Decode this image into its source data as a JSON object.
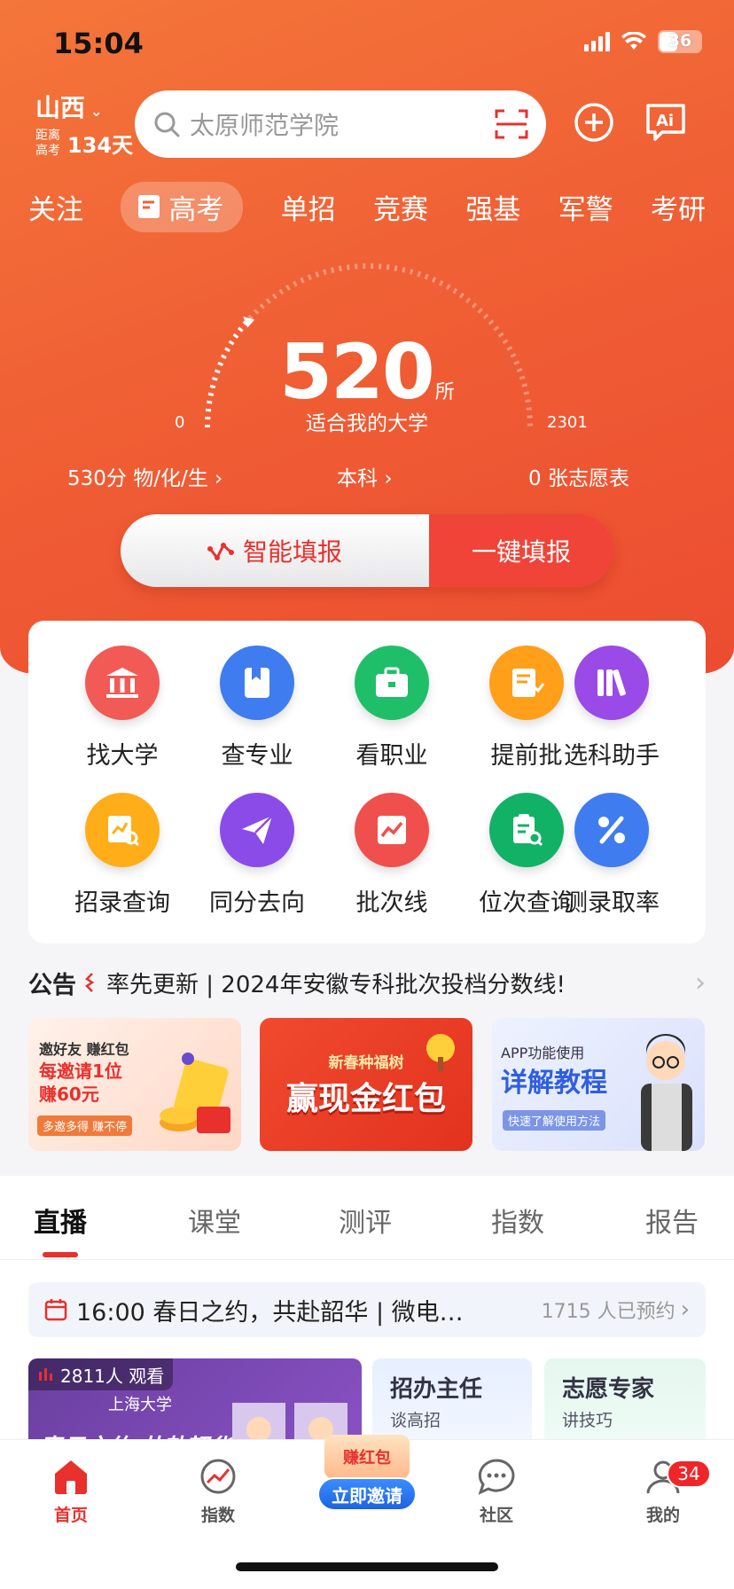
{
  "status": {
    "time": "15:04",
    "battery": "36"
  },
  "location": {
    "province": "山西",
    "countdown_label": "距离高考",
    "countdown_value": "134天"
  },
  "search": {
    "placeholder": "太原师范学院"
  },
  "categories": [
    "关注",
    "高考",
    "单招",
    "竞赛",
    "强基",
    "军警",
    "考研"
  ],
  "gauge": {
    "count": "520",
    "unit": "所",
    "subtitle": "适合我的大学",
    "min": "0",
    "max": "2301",
    "fill_fraction": 0.23
  },
  "stats": {
    "score": "530分 物/化/生",
    "level": "本科",
    "forms": "0 张志愿表"
  },
  "fill_buttons": {
    "smart": "智能填报",
    "one_click": "一键填报"
  },
  "functions": [
    {
      "label": "找大学",
      "icon": "university-icon",
      "color": "#f25a56"
    },
    {
      "label": "查专业",
      "icon": "book-icon",
      "color": "#3f7cf0"
    },
    {
      "label": "看职业",
      "icon": "briefcase-icon",
      "color": "#1fbf6a"
    },
    {
      "label": "提前批",
      "icon": "document-arrow-icon",
      "color": "#ff9f1a"
    },
    {
      "label": "选科助手",
      "icon": "books-icon",
      "color": "#9a4ae6"
    },
    {
      "label": "招录查询",
      "icon": "chart-search-icon",
      "color": "#ffae1a"
    },
    {
      "label": "同分去向",
      "icon": "paper-plane-icon",
      "color": "#8b4be8"
    },
    {
      "label": "批次线",
      "icon": "trend-line-icon",
      "color": "#f0504d"
    },
    {
      "label": "位次查询",
      "icon": "clipboard-search-icon",
      "color": "#12b266"
    },
    {
      "label": "测录取率",
      "icon": "percent-icon",
      "color": "#3f7cf0"
    }
  ],
  "notice": {
    "tag": "公告",
    "text": "率先更新 | 2024年安徽专科批次投档分数线!"
  },
  "banners": {
    "invite": {
      "line1": "邀好友 赚红包",
      "line2": "每邀请1位",
      "line3": "赚60元",
      "tag": "多邀多得 赚不停"
    },
    "red_packet": {
      "top": "新春种福树",
      "main": "赢现金红包"
    },
    "tutorial": {
      "line1": "APP功能使用",
      "line2": "详解教程",
      "tag": "快速了解使用方法"
    }
  },
  "content_tabs": [
    "直播",
    "课堂",
    "测评",
    "指数",
    "报告"
  ],
  "live": {
    "title": "16:00 春日之约，共赴韶华 | 微电…",
    "reserved": "1715 人已预约"
  },
  "cards": {
    "live_card": {
      "viewers": "2811人 观看",
      "school": "上海大学",
      "caption": "春日之约 共赴韶华"
    },
    "card2": {
      "title": "招办主任",
      "sub": "谈高招"
    },
    "card3": {
      "title": "志愿专家",
      "sub": "讲技巧"
    }
  },
  "nav": {
    "home": "首页",
    "index": "指数",
    "invite_top": "赚红包",
    "invite_btn": "立即邀请",
    "community": "社区",
    "mine": "我的",
    "mine_badge": "34"
  },
  "colors": {
    "brand": "#f06035",
    "accent_red": "#e8302c"
  }
}
